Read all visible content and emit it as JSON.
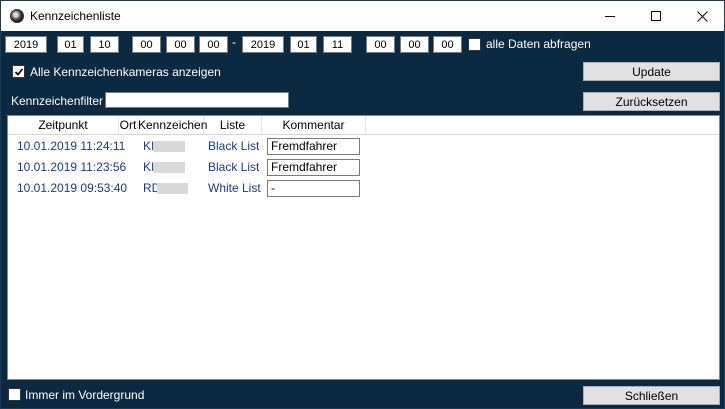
{
  "window": {
    "title": "Kennzeichenliste"
  },
  "date_range": {
    "from": {
      "year": "2019",
      "month": "01",
      "day": "10",
      "hour": "00",
      "minute": "00",
      "second": "00"
    },
    "separator": "-",
    "to": {
      "year": "2019",
      "month": "01",
      "day": "11",
      "hour": "00",
      "minute": "00",
      "second": "00"
    }
  },
  "options": {
    "all_data": {
      "label": "alle Daten abfragen",
      "checked": false
    },
    "all_cameras": {
      "label": "Alle Kennzeichenkameras anzeigen",
      "checked": true
    },
    "always_on_top": {
      "label": "Immer im Vordergrund",
      "checked": false
    }
  },
  "filter": {
    "label": "Kennzeichenfilter",
    "value": ""
  },
  "buttons": {
    "update": "Update",
    "reset": "Zurücksetzen",
    "close": "Schließen"
  },
  "table": {
    "columns": [
      "Zeitpunkt",
      "Ort",
      "Kennzeichen",
      "Liste",
      "Kommentar"
    ],
    "rows": [
      {
        "zeitpunkt": "10.01.2019 11:24:11",
        "ort": "",
        "kennzeichen": "KI",
        "liste": "Black List",
        "kommentar": "Fremdfahrer"
      },
      {
        "zeitpunkt": "10.01.2019 11:23:56",
        "ort": "",
        "kennzeichen": "KI",
        "liste": "Black List",
        "kommentar": "Fremdfahrer"
      },
      {
        "zeitpunkt": "10.01.2019 09:53:40",
        "ort": "",
        "kennzeichen": "RD",
        "liste": "White List",
        "kommentar": "-"
      }
    ]
  },
  "colors": {
    "panel": "#0b2a42",
    "link_text": "#1a3a8a"
  },
  "icons": {
    "app": "camera-lens-icon",
    "checkmark": "checkmark-icon"
  }
}
